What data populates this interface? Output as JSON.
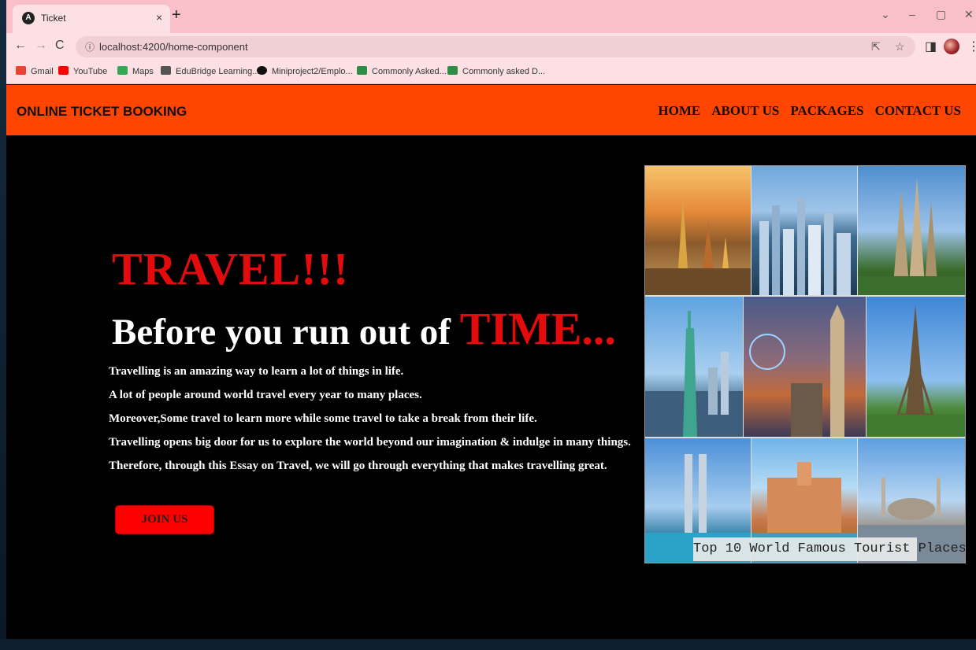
{
  "browser": {
    "tab_title": "Ticket",
    "tab_favicon": "A",
    "close_glyph": "×",
    "new_tab_glyph": "+",
    "url": "localhost:4200/home-component",
    "window_controls": {
      "dropdown": "⌄",
      "minimize": "–",
      "maximize": "▢",
      "close": "✕"
    },
    "bookmarks": [
      {
        "label": "Gmail",
        "icon": "gmail-icon",
        "color": "#ea4335"
      },
      {
        "label": "YouTube",
        "icon": "youtube-icon",
        "color": "#ff0000"
      },
      {
        "label": "Maps",
        "icon": "maps-icon",
        "color": "#34a853"
      },
      {
        "label": "EduBridge Learning...",
        "icon": "edubridge-icon",
        "color": "#555555"
      },
      {
        "label": "Miniproject2/Emplo...",
        "icon": "github-icon",
        "color": "#111111"
      },
      {
        "label": "Commonly Asked...",
        "icon": "geeksforgeeks-icon",
        "color": "#2f8d46"
      },
      {
        "label": "Commonly asked D...",
        "icon": "geeksforgeeks-icon",
        "color": "#2f8d46"
      }
    ]
  },
  "site": {
    "brand": "ONLINE TICKET BOOKING",
    "nav": [
      "HOME",
      "ABOUT US",
      "PACKAGES",
      "CONTACT US"
    ],
    "colors": {
      "navbar": "#ff4500",
      "accent_red": "#e30b0b",
      "background": "#000000"
    }
  },
  "hero": {
    "headline": "TRAVEL!!!",
    "subheadline_prefix": "Before you run out of ",
    "subheadline_highlight": "TIME...",
    "paragraphs": [
      "Travelling is an amazing way to learn a lot of things in life.",
      "A lot of people around world travel every year to many places.",
      "Moreover,Some travel to learn more while some travel to take a break from their life.",
      "Travelling opens big door for us to explore the world beyond our imagination & indulge in many things.",
      "Therefore, through this Essay on Travel, we will go through everything that makes travelling great."
    ],
    "join_button": "JOIN US"
  },
  "collage": {
    "caption": "Top 10 World Famous Tourist Places"
  }
}
